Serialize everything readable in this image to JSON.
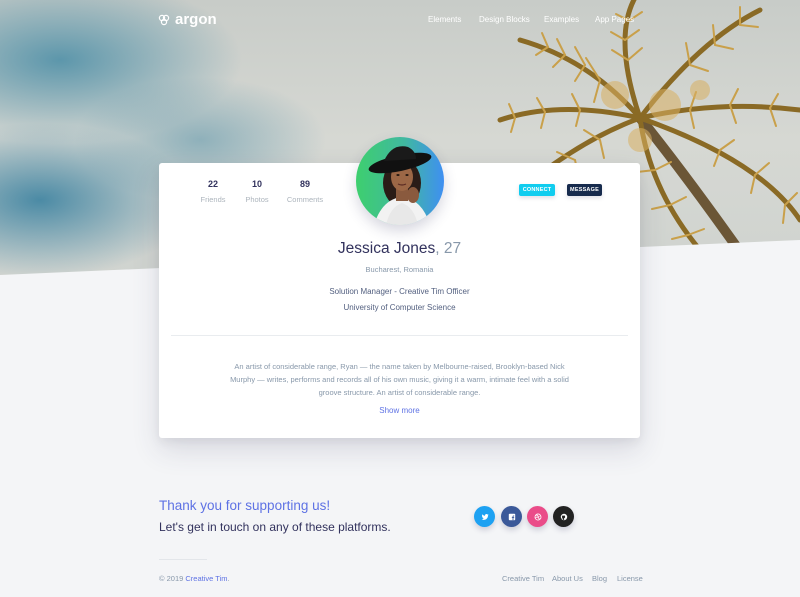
{
  "nav": {
    "brand": "argon",
    "links": [
      "Elements",
      "Design Blocks",
      "Examples",
      "App Pages"
    ]
  },
  "profile": {
    "stats": [
      {
        "value": "22",
        "label": "Friends"
      },
      {
        "value": "10",
        "label": "Photos"
      },
      {
        "value": "89",
        "label": "Comments"
      }
    ],
    "connect_label": "CONNECT",
    "message_label": "MESSAGE",
    "name": "Jessica Jones",
    "age": ", 27",
    "location": "Bucharest, Romania",
    "job": "Solution Manager - Creative Tim Officer",
    "school": "University of Computer Science",
    "bio": "An artist of considerable range, Ryan — the name taken by Melbourne-raised, Brooklyn-based Nick Murphy — writes, performs and records all of his own music, giving it a warm, intimate feel with a solid groove structure. An artist of considerable range.",
    "show_more": "Show more"
  },
  "footer": {
    "thanks": "Thank you for supporting us!",
    "touch": "Let's get in touch on any of these platforms.",
    "social": [
      "twitter-icon",
      "facebook-icon",
      "dribbble-icon",
      "github-icon"
    ],
    "copyright_prefix": "© 2019 ",
    "copyright_link": "Creative Tim",
    "copyright_suffix": ".",
    "links": [
      "Creative Tim",
      "About Us",
      "Blog",
      "License"
    ]
  },
  "colors": {
    "primary": "#5e72e4",
    "info": "#11cdef",
    "default": "#172b4d",
    "twitter": "#1da1f2",
    "facebook": "#3b5999",
    "dribbble": "#ea4c89",
    "github": "#222222"
  }
}
